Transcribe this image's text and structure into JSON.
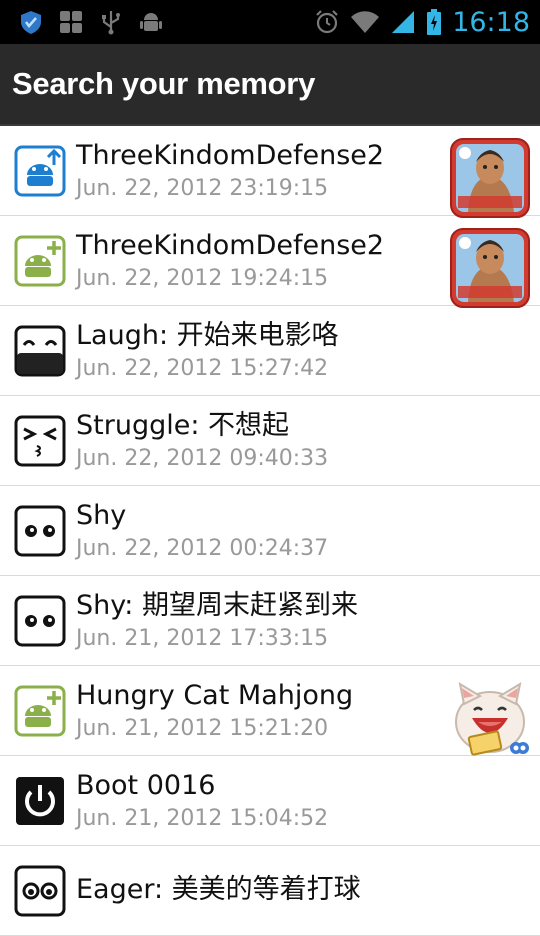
{
  "status_bar": {
    "time": "16:18",
    "left_icons": [
      "shield-icon",
      "grid-app-icon",
      "usb-icon",
      "android-debug-icon"
    ],
    "right_icons": [
      "alarm-icon",
      "wifi-icon",
      "signal-icon",
      "battery-charging-icon"
    ],
    "accent": "#33b5e5"
  },
  "header": {
    "title": "Search your memory"
  },
  "items": [
    {
      "icon": "app-upgrade-icon",
      "title": "ThreeKindomDefense2",
      "time": "Jun. 22, 2012 23:19:15",
      "thumb": "three-kingdom-defense-app-icon"
    },
    {
      "icon": "app-install-icon",
      "title": "ThreeKindomDefense2",
      "time": "Jun. 22, 2012 19:24:15",
      "thumb": "three-kingdom-defense-app-icon"
    },
    {
      "icon": "laugh-face-icon",
      "title": "Laugh: 开始来电影咯",
      "time": "Jun. 22, 2012 15:27:42"
    },
    {
      "icon": "struggle-face-icon",
      "title": "Struggle: 不想起",
      "time": "Jun. 22, 2012 09:40:33"
    },
    {
      "icon": "shy-face-icon",
      "title": "Shy",
      "time": "Jun. 22, 2012 00:24:37"
    },
    {
      "icon": "shy-face-icon",
      "title": "Shy: 期望周末赶紧到来",
      "time": "Jun. 21, 2012 17:33:15"
    },
    {
      "icon": "app-install-icon",
      "title": "Hungry Cat Mahjong",
      "time": "Jun. 21, 2012 15:21:20",
      "thumb": "hungry-cat-mahjong-app-icon"
    },
    {
      "icon": "power-icon",
      "title": "Boot 0016",
      "time": "Jun. 21, 2012 15:04:52"
    },
    {
      "icon": "eager-face-icon",
      "title": "Eager: 美美的等着打球",
      "time": ""
    }
  ]
}
